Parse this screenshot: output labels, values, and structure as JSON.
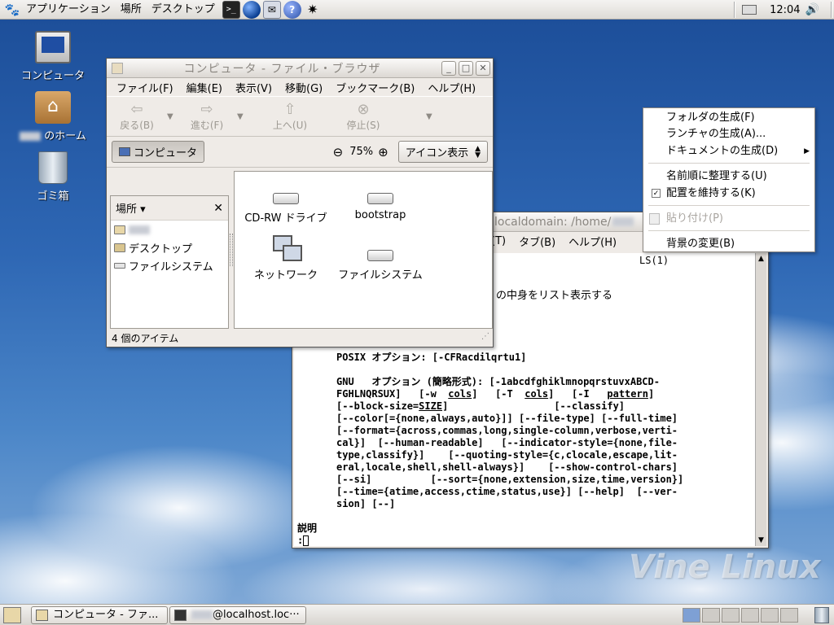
{
  "top_panel": {
    "menus": [
      "アプリケーション",
      "場所",
      "デスクトップ"
    ],
    "launchers": [
      "terminal-icon",
      "globe-icon",
      "mail-icon",
      "help-icon",
      "bug-icon"
    ],
    "clock": "12:04"
  },
  "desktop_icons": [
    {
      "label": "コンピュータ",
      "icon": "computer-icon"
    },
    {
      "label": "のホーム",
      "icon": "home-folder-icon"
    },
    {
      "label": "ゴミ箱",
      "icon": "trash-icon"
    }
  ],
  "file_browser": {
    "title": "コンピュータ - ファイル・ブラウザ",
    "menus": [
      "ファイル(F)",
      "編集(E)",
      "表示(V)",
      "移動(G)",
      "ブックマーク(B)",
      "ヘルプ(H)"
    ],
    "toolbar": {
      "back": "戻る(B)",
      "forward": "進む(F)",
      "up": "上へ(U)",
      "stop": "停止(S)"
    },
    "location_button": "コンピュータ",
    "zoom": "75%",
    "view_mode": "アイコン表示",
    "side_pane_title": "場所",
    "places": [
      "デスクトップ",
      "ファイルシステム"
    ],
    "items": [
      "CD-RW ドライブ",
      "bootstrap",
      "ネットワーク",
      "ファイルシステム"
    ],
    "status": "4 個のアイテム"
  },
  "terminal": {
    "title_fragment": "localdomain: /home/",
    "menus": [
      "(T)",
      "タブ(B)",
      "ヘルプ(H)"
    ],
    "lines": {
      "header_right": "LS(1)",
      "desc": "の中身をリスト表示する",
      "posix": "POSIX オプション: [-CFRacdilqrtu1]",
      "gnu1": "GNU   オプション (簡略形式): [-1abcdfghiklmnopqrstuvxABCD-",
      "gnu2a": "FGHLNQRSUX]   [-w  ",
      "gnu2_cols1": "cols",
      "gnu2b": "]   [-T  ",
      "gnu2_cols2": "cols",
      "gnu2c": "]   [-I   ",
      "gnu2_pattern": "pattern",
      "gnu2d": "]",
      "gnu3a": "[--block-size=",
      "gnu3_size": "SIZE",
      "gnu3b": "]                  [--classify]",
      "gnu4": "[--color[={none,always,auto}]] [--file-type] [--full-time]",
      "gnu5": "[--format={across,commas,long,single-column,verbose,verti-",
      "gnu6": "cal}]  [--human-readable]   [--indicator-style={none,file-",
      "gnu7": "type,classify}]    [--quoting-style={c,clocale,escape,lit-",
      "gnu8": "eral,locale,shell,shell-always}]    [--show-control-chars]",
      "gnu9": "[--si]          [--sort={none,extension,size,time,version}]",
      "gnu10": "[--time={atime,access,ctime,status,use}] [--help]  [--ver-",
      "gnu11": "sion] [--]",
      "section": "説明",
      "prompt": ":"
    }
  },
  "context_menu": {
    "items": [
      {
        "label": "フォルダの生成(F)",
        "enabled": true
      },
      {
        "label": "ランチャの生成(A)...",
        "enabled": true
      },
      {
        "label": "ドキュメントの生成(D)",
        "enabled": true,
        "submenu": true
      },
      {
        "label": "名前順に整理する(U)",
        "enabled": true
      },
      {
        "label": "配置を維持する(K)",
        "enabled": true,
        "checked": true
      },
      {
        "label": "貼り付け(P)",
        "enabled": false
      },
      {
        "label": "背景の変更(B)",
        "enabled": true
      }
    ]
  },
  "watermark": "Vine Linux",
  "bottom_panel": {
    "tasks": [
      "コンピュータ - ファ...",
      "@localhost.loc···"
    ]
  }
}
